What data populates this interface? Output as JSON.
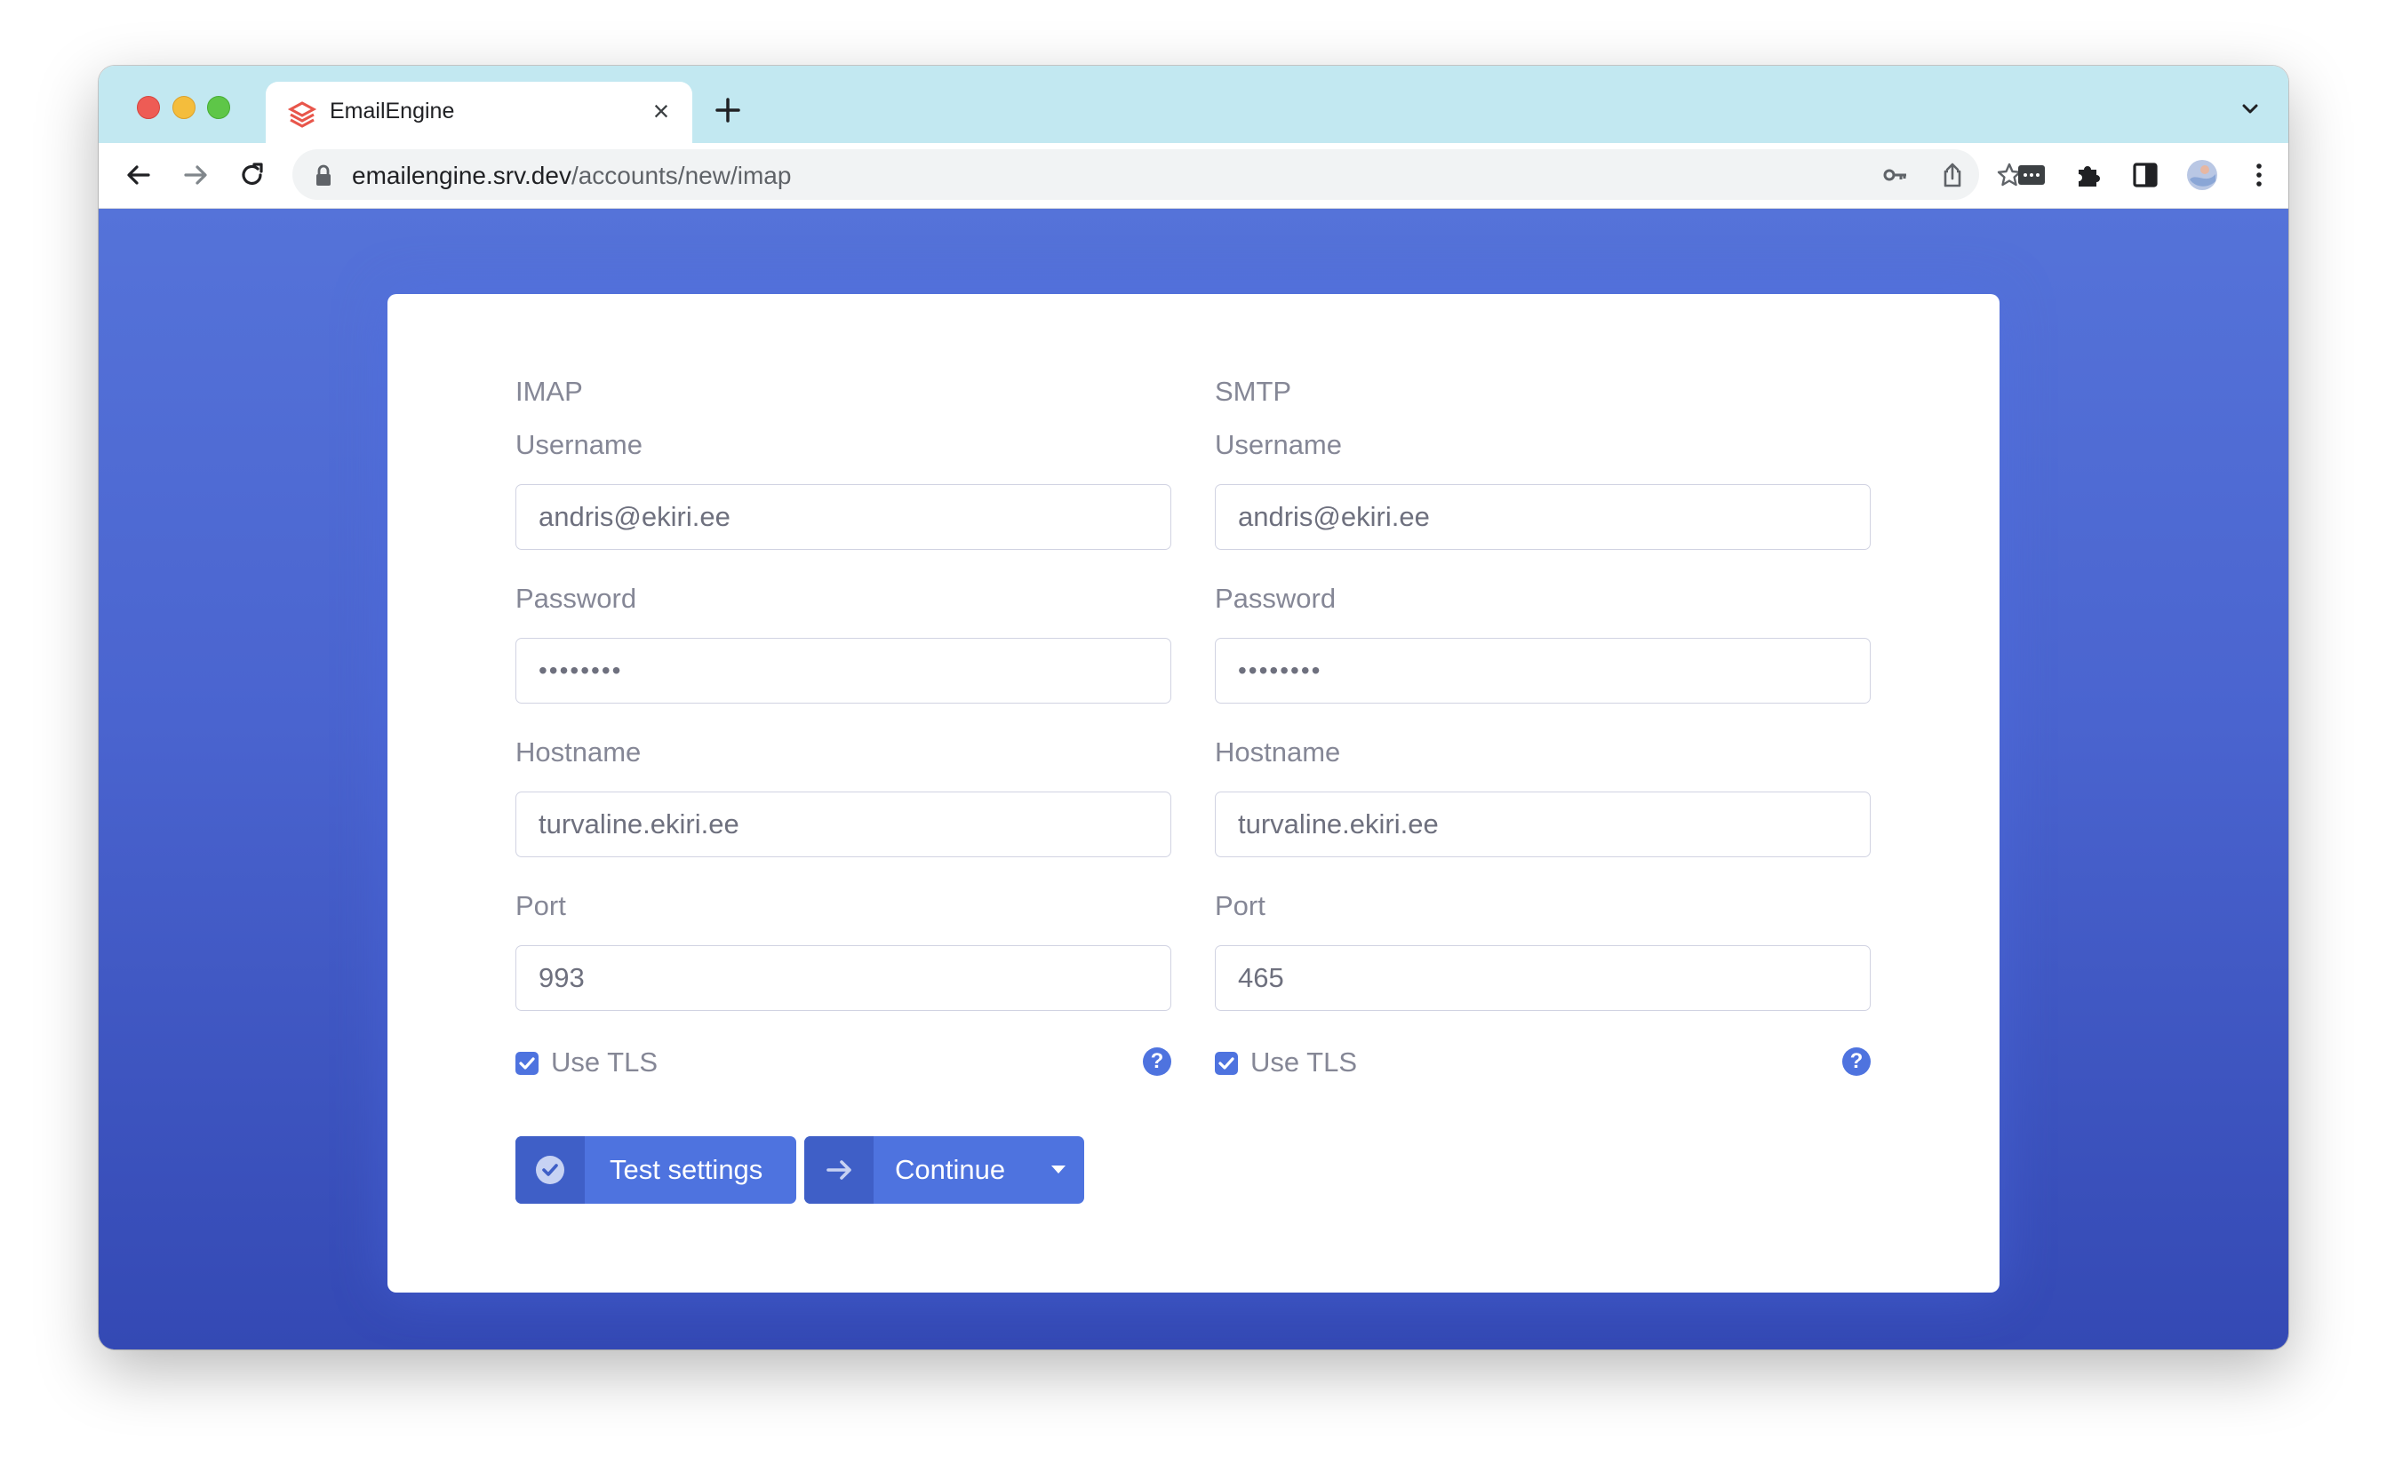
{
  "browser": {
    "tab_title": "EmailEngine",
    "url_host": "emailengine.srv.dev",
    "url_path": "/accounts/new/imap",
    "colors": {
      "tabstrip": "#c2e8f1"
    }
  },
  "form": {
    "imap": {
      "title": "IMAP",
      "username_label": "Username",
      "username_value": "andris@ekiri.ee",
      "password_label": "Password",
      "password_value": "••••••••",
      "hostname_label": "Hostname",
      "hostname_value": "turvaline.ekiri.ee",
      "port_label": "Port",
      "port_value": "993",
      "tls_label": "Use TLS",
      "tls_checked": true
    },
    "smtp": {
      "title": "SMTP",
      "username_label": "Username",
      "username_value": "andris@ekiri.ee",
      "password_label": "Password",
      "password_value": "••••••••",
      "hostname_label": "Hostname",
      "hostname_value": "turvaline.ekiri.ee",
      "port_label": "Port",
      "port_value": "465",
      "tls_label": "Use TLS",
      "tls_checked": true
    },
    "buttons": {
      "test_label": "Test settings",
      "continue_label": "Continue"
    },
    "colors": {
      "primary": "#4e73df",
      "label": "#858796"
    }
  }
}
